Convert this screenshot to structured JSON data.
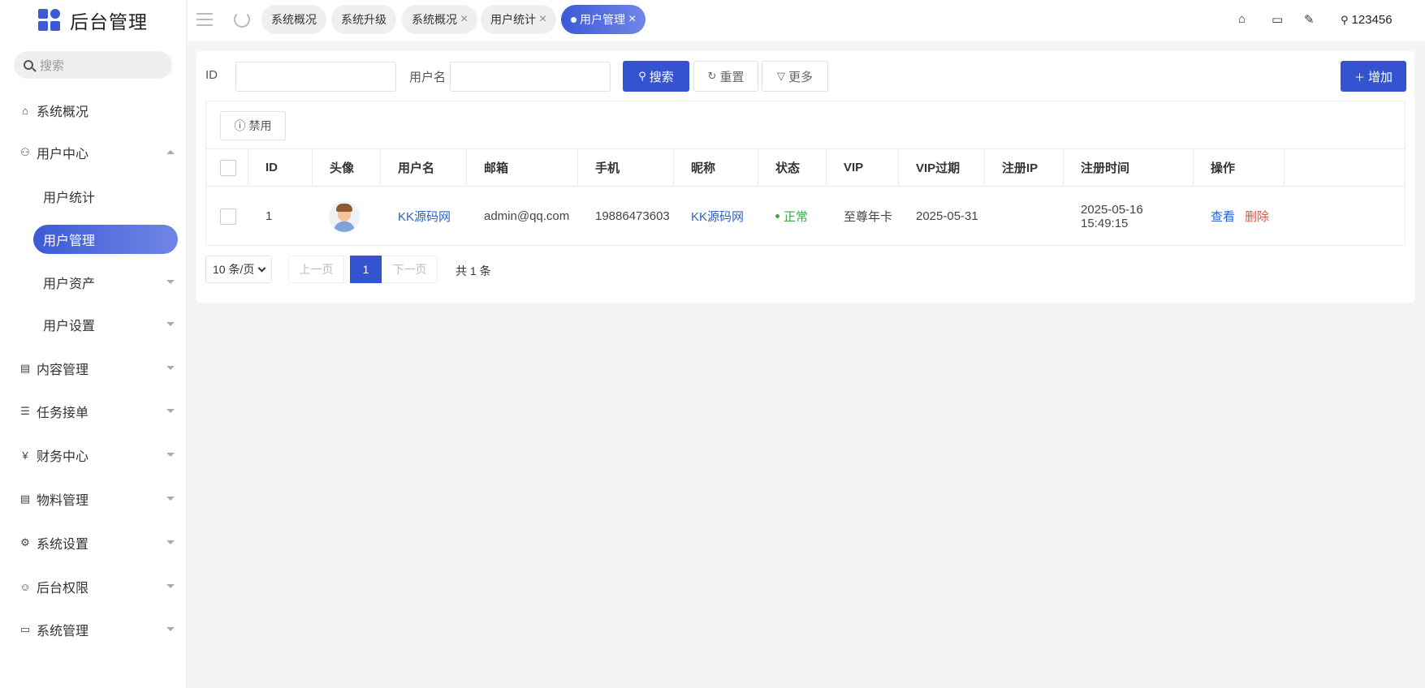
{
  "app": {
    "title": "后台管理"
  },
  "sidebar": {
    "search_placeholder": "搜索",
    "items": [
      {
        "label": "系统概况",
        "icon": "home-icon"
      },
      {
        "label": "用户中心",
        "icon": "users-icon",
        "expanded": true
      },
      {
        "label": "内容管理",
        "icon": "document-icon"
      },
      {
        "label": "任务接单",
        "icon": "list-icon"
      },
      {
        "label": "财务中心",
        "icon": "yen-icon"
      },
      {
        "label": "物料管理",
        "icon": "file-icon"
      },
      {
        "label": "系统设置",
        "icon": "gear-icon"
      },
      {
        "label": "后台权限",
        "icon": "user-circle-icon"
      },
      {
        "label": "系统管理",
        "icon": "code-icon"
      }
    ],
    "sub_items": [
      {
        "label": "用户统计"
      },
      {
        "label": "用户管理",
        "active": true
      },
      {
        "label": "用户资产"
      },
      {
        "label": "用户设置"
      }
    ]
  },
  "tabs": [
    {
      "label": "系统概况"
    },
    {
      "label": "系统升级"
    },
    {
      "label": "系统概况"
    },
    {
      "label": "用户统计"
    },
    {
      "label": "用户管理",
      "active": true
    }
  ],
  "header": {
    "username": "123456",
    "close_glyph": "×"
  },
  "filters": {
    "id_label": "ID",
    "id_value": "",
    "username_label": "用户名",
    "username_value": "",
    "search_label": "搜索",
    "reset_label": "重置",
    "more_label": "更多",
    "add_label": "增加"
  },
  "table": {
    "toolbar_disable": "禁用",
    "columns": [
      "ID",
      "头像",
      "用户名",
      "邮箱",
      "手机",
      "昵称",
      "状态",
      "VIP",
      "VIP过期",
      "注册IP",
      "注册时间",
      "操作"
    ],
    "rows": [
      {
        "id": "1",
        "username": "KK源码网",
        "email": "admin@qq.com",
        "phone": "19886473603",
        "nickname": "KK源码网",
        "status": "正常",
        "vip": "至尊年卡",
        "vip_expire": "2025-05-31",
        "reg_ip": "",
        "reg_time": "2025-05-16 15:49:15",
        "action_view": "查看",
        "action_delete": "删除"
      }
    ]
  },
  "pagination": {
    "page_size": "10 条/页",
    "prev": "上一页",
    "current": "1",
    "next": "下一页",
    "total": "共 1 条"
  },
  "colors": {
    "primary": "#3453d1",
    "link": "#2e61c9",
    "danger": "#e0523f",
    "success": "#3fa64a"
  }
}
